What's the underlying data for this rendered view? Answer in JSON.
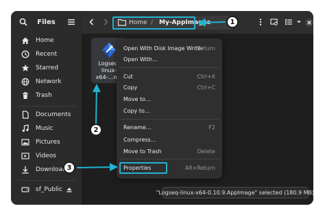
{
  "sidebar": {
    "title": "Files",
    "search_icon": "search-icon",
    "menu_icon": "hamburger-menu-icon",
    "items": [
      {
        "label": "Home",
        "icon": "home-icon"
      },
      {
        "label": "Recent",
        "icon": "clock-icon"
      },
      {
        "label": "Starred",
        "icon": "star-icon"
      },
      {
        "label": "Network",
        "icon": "network-icon"
      },
      {
        "label": "Trash",
        "icon": "trash-icon"
      },
      {
        "label": "Documents",
        "icon": "document-icon"
      },
      {
        "label": "Music",
        "icon": "music-icon"
      },
      {
        "label": "Pictures",
        "icon": "pictures-icon"
      },
      {
        "label": "Videos",
        "icon": "video-icon"
      },
      {
        "label": "Downloads",
        "icon": "download-icon"
      },
      {
        "label": "sf_Public",
        "icon": "drive-icon"
      }
    ]
  },
  "header": {
    "breadcrumb": [
      "Home",
      "/",
      "My-AppImages"
    ]
  },
  "file": {
    "name_lines": [
      "Logseq-",
      "linux-",
      "x64-…ma"
    ]
  },
  "context_menu": {
    "items": [
      {
        "label": "Open With Disk Image Writer",
        "shortcut": "Return"
      },
      {
        "label": "Open With…",
        "shortcut": ""
      },
      {
        "label": "Cut",
        "shortcut": "Ctrl+X"
      },
      {
        "label": "Copy",
        "shortcut": "Ctrl+C"
      },
      {
        "label": "Move to…",
        "shortcut": ""
      },
      {
        "label": "Copy to…",
        "shortcut": ""
      },
      {
        "label": "Rename…",
        "shortcut": "F2"
      },
      {
        "label": "Compress…",
        "shortcut": ""
      },
      {
        "label": "Move to Trash",
        "shortcut": "Delete"
      },
      {
        "label": "Properties",
        "shortcut": "Alt+Return"
      }
    ]
  },
  "status": {
    "text": "\"Logseq-linux-x64-0.10.9.AppImage\" selected  (180.9 MB)"
  },
  "callouts": [
    "1",
    "2",
    "3"
  ],
  "colors": {
    "highlight": "#20b3d6",
    "window_bg": "#1e1e1e",
    "sidebar_bg": "#2b2b2b"
  }
}
